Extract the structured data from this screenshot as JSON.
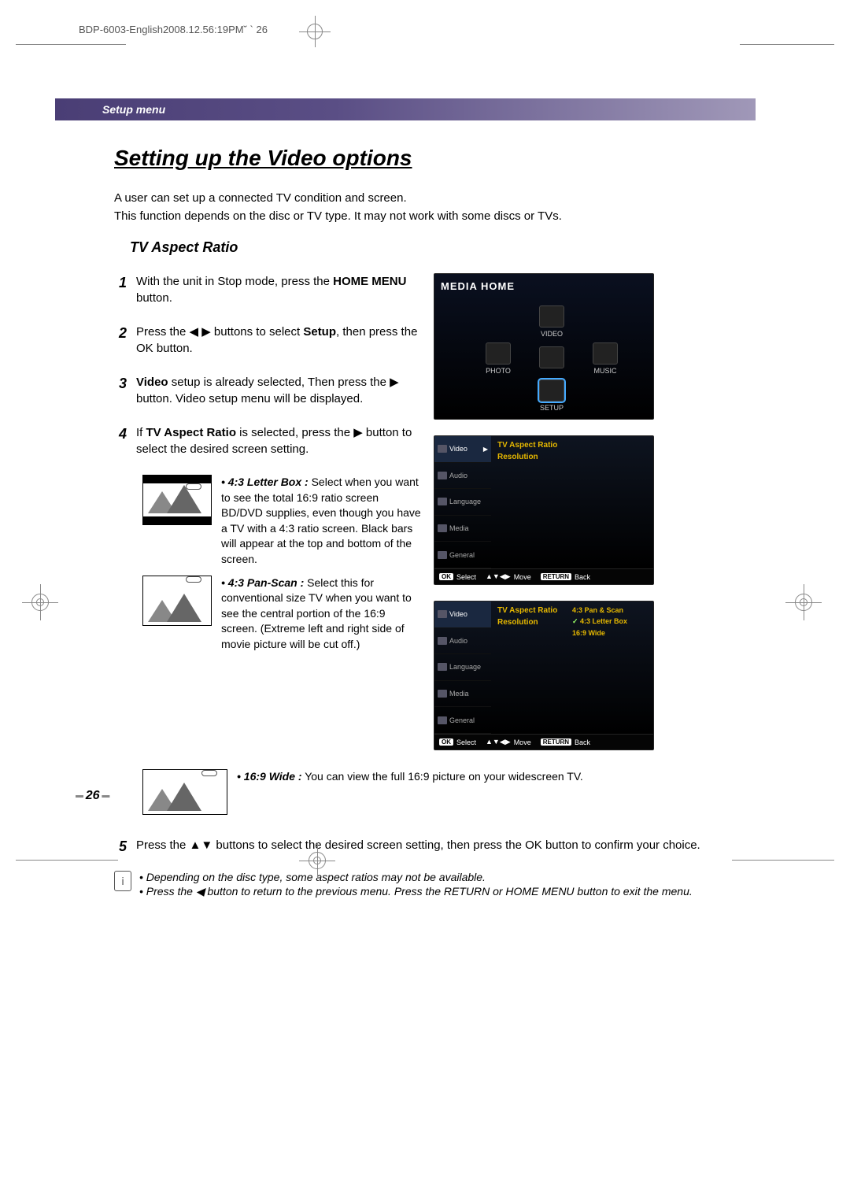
{
  "crop_header": "BDP-6003-English2008.12.56:19PM˘   `   26",
  "band_label": "Setup menu",
  "section_title": "Setting up the Video options",
  "intro_line1": "A user can set up a connected TV condition and screen.",
  "intro_line2": "This function depends on the disc or TV type. It may not work with some discs or TVs.",
  "sub_title": "TV Aspect Ratio",
  "steps": {
    "s1a": "With the unit in Stop mode, press the ",
    "s1b": "HOME MENU",
    "s1c": " button.",
    "s2a": "Press the ◀ ▶ buttons to select ",
    "s2b": "Setup",
    "s2c": ", then press the OK button.",
    "s3a": "Video",
    "s3b": " setup is already selected, Then press the ▶ button. Video setup menu will be displayed.",
    "s4a": "If ",
    "s4b": "TV Aspect Ratio",
    "s4c": " is selected, press the ▶ button to select the desired screen setting.",
    "s5": "Press the ▲▼ buttons to select the desired screen setting, then press the OK button to confirm your choice."
  },
  "modes": {
    "letterbox_label": "• 4:3 Letter Box :",
    "letterbox_text": "  Select when you want to see the total 16:9 ratio screen BD/DVD supplies, even though you have a TV with a 4:3 ratio screen. Black bars will appear at the top and bottom of the screen.",
    "panscan_label": "• 4:3 Pan-Scan :",
    "panscan_text": "  Select this for conventional size TV when you want to see the central portion of the 16:9 screen. (Extreme left and right side of movie picture will be cut off.)",
    "wide_label": "• 16:9 Wide :",
    "wide_text": "   You can view the full 16:9 picture on your widescreen TV."
  },
  "notes": {
    "n1": "• Depending on the disc type, some aspect ratios may not be available.",
    "n2": "• Press the ◀ button to return to the previous menu. Press the RETURN or HOME MENU button to exit the menu."
  },
  "page_number": "26",
  "osd": {
    "media_home_title": "MEDIA HOME",
    "home_icons": {
      "video": "VIDEO",
      "photo": "PHOTO",
      "music": "MUSIC",
      "setup": "SETUP",
      "tv": ""
    },
    "sidebar": {
      "video": "Video",
      "audio": "Audio",
      "language": "Language",
      "media": "Media",
      "general": "General"
    },
    "main": {
      "tv_aspect": "TV Aspect Ratio",
      "resolution": "Resolution"
    },
    "options": {
      "o1": "4:3 Pan & Scan",
      "o2": "4:3 Letter Box",
      "o3": "16:9 Wide"
    },
    "footer": {
      "ok": "OK",
      "select": "Select",
      "move_sym": "▲▼◀▶",
      "move": "Move",
      "return": "RETURN",
      "back": "Back"
    }
  }
}
